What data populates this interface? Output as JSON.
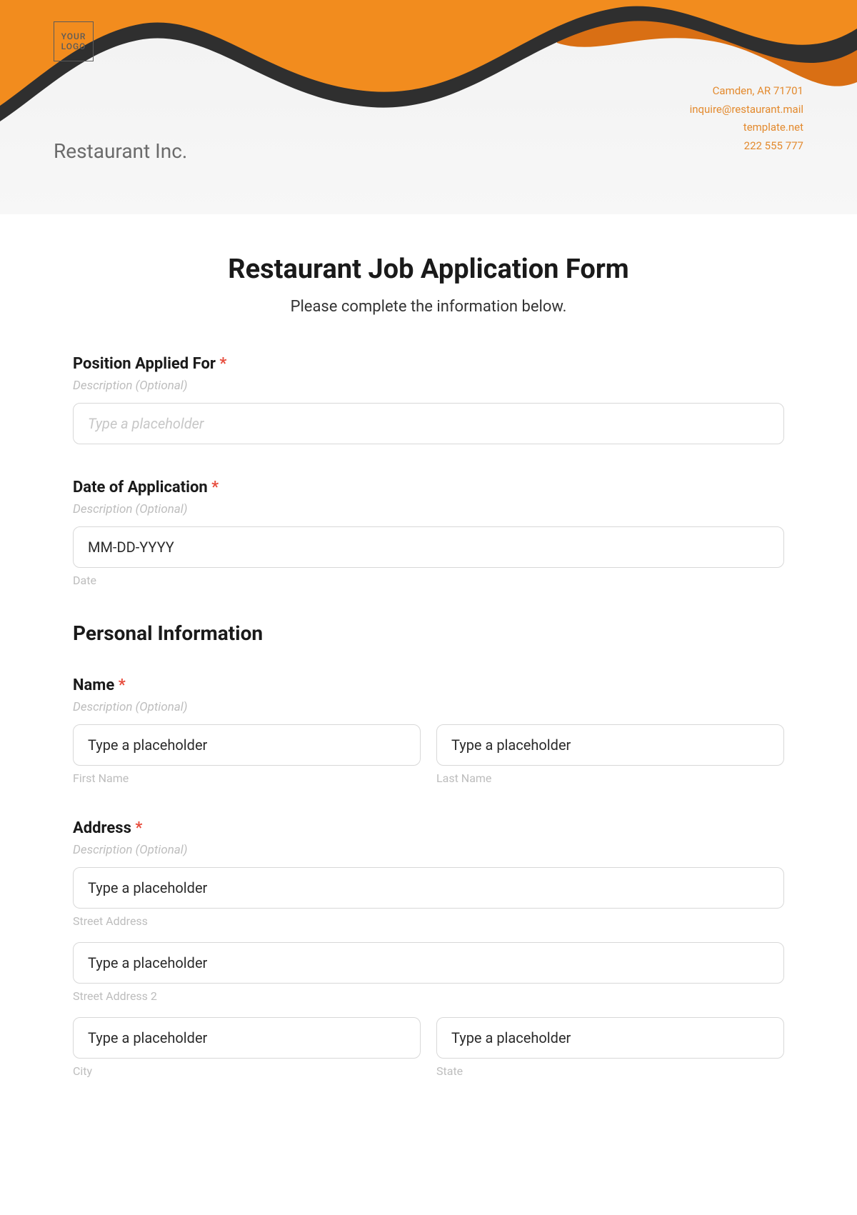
{
  "header": {
    "logo_text": "YOUR LOGO",
    "brand": "Restaurant Inc.",
    "contact": {
      "address": "Camden, AR 71701",
      "email": "inquire@restaurant.mail",
      "site": "template.net",
      "phone": "222 555 777"
    }
  },
  "form": {
    "title": "Restaurant Job Application Form",
    "subtitle": "Please complete the information below.",
    "position": {
      "label": "Position Applied For",
      "desc": "Description (Optional)",
      "placeholder": "Type a placeholder"
    },
    "date": {
      "label": "Date of Application",
      "desc": "Description (Optional)",
      "placeholder": "MM-DD-YYYY",
      "sublabel": "Date"
    },
    "personal_section": "Personal Information",
    "name": {
      "label": "Name",
      "desc": "Description (Optional)",
      "first_placeholder": "Type a placeholder",
      "first_sublabel": "First Name",
      "last_placeholder": "Type a placeholder",
      "last_sublabel": "Last Name"
    },
    "address": {
      "label": "Address",
      "desc": "Description (Optional)",
      "street1_placeholder": "Type a placeholder",
      "street1_sublabel": "Street Address",
      "street2_placeholder": "Type a placeholder",
      "street2_sublabel": "Street Address 2",
      "city_placeholder": "Type a placeholder",
      "city_sublabel": "City",
      "state_placeholder": "Type a placeholder",
      "state_sublabel": "State"
    },
    "required_mark": "*"
  }
}
